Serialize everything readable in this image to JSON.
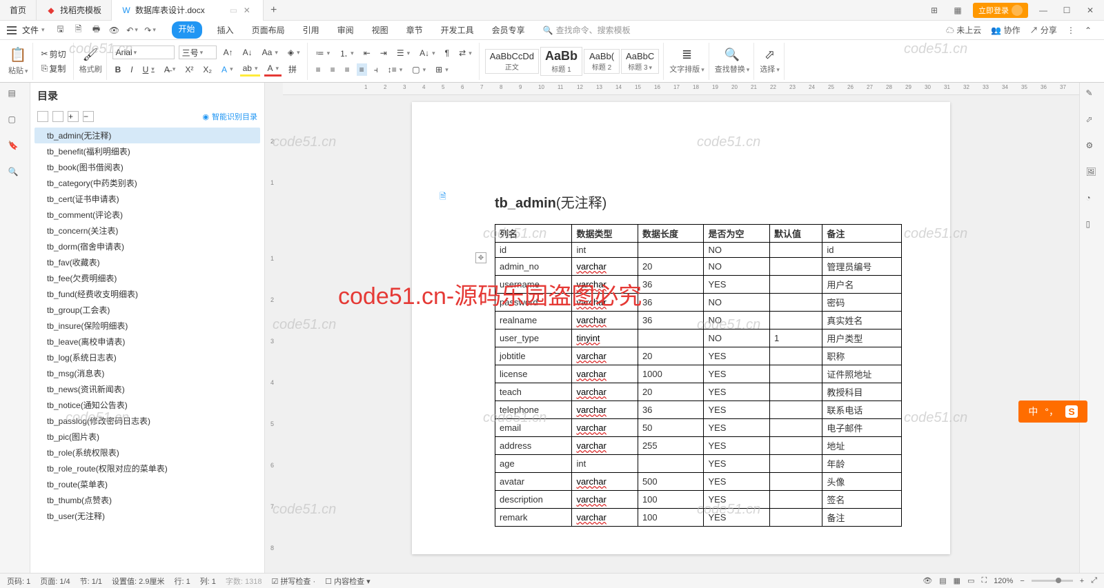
{
  "titlebar": {
    "tabs": [
      {
        "label": "首页",
        "icon_color": "#2196f3"
      },
      {
        "label": "找稻壳模板",
        "icon_color": "#e53935"
      },
      {
        "label": "数据库表设计.docx",
        "icon_color": "#2196f3",
        "active": true
      }
    ],
    "login": "立即登录"
  },
  "menubar": {
    "file": "文件",
    "tabs": [
      "开始",
      "插入",
      "页面布局",
      "引用",
      "审阅",
      "视图",
      "章节",
      "开发工具",
      "会员专享"
    ],
    "search_placeholder": "查找命令、搜索模板",
    "right": {
      "cloud": "未上云",
      "collab": "协作",
      "share": "分享"
    }
  },
  "ribbon": {
    "clipboard": {
      "paste": "粘贴",
      "cut": "剪切",
      "copy": "复制",
      "fmtpainter": "格式刷"
    },
    "font": {
      "name": "Arial",
      "size": "三号"
    },
    "styles": [
      {
        "preview": "AaBbCcDd",
        "label": "正文"
      },
      {
        "preview": "AaBb",
        "label": "标题 1",
        "big": true
      },
      {
        "preview": "AaBb(",
        "label": "标题 2"
      },
      {
        "preview": "AaBbC",
        "label": "标题 3"
      }
    ],
    "tools": {
      "layout": "文字排版",
      "findreplace": "查找替换",
      "select": "选择"
    }
  },
  "outline": {
    "title": "目录",
    "smart": "智能识别目录",
    "items": [
      "tb_admin(无注释)",
      "tb_benefit(福利明细表)",
      "tb_book(图书借阅表)",
      "tb_category(中药类别表)",
      "tb_cert(证书申请表)",
      "tb_comment(评论表)",
      "tb_concern(关注表)",
      "tb_dorm(宿舍申请表)",
      "tb_fav(收藏表)",
      "tb_fee(欠费明细表)",
      "tb_fund(经费收支明细表)",
      "tb_group(工会表)",
      "tb_insure(保险明细表)",
      "tb_leave(离校申请表)",
      "tb_log(系统日志表)",
      "tb_msg(消息表)",
      "tb_news(资讯新闻表)",
      "tb_notice(通知公告表)",
      "tb_passlog(修改密码日志表)",
      "tb_pic(图片表)",
      "tb_role(系统权限表)",
      "tb_role_route(权限对应的菜单表)",
      "tb_route(菜单表)",
      "tb_thumb(点赞表)",
      "tb_user(无注释)"
    ],
    "selected": 0
  },
  "document": {
    "heading_name": "tb_admin",
    "heading_note": "(无注释)",
    "columns": [
      "列名",
      "数据类型",
      "数据长度",
      "是否为空",
      "默认值",
      "备注"
    ],
    "rows": [
      [
        "id",
        "int",
        "",
        "NO",
        "",
        "id"
      ],
      [
        "admin_no",
        "varchar",
        "20",
        "NO",
        "",
        "管理员编号"
      ],
      [
        "username",
        "varchar",
        "36",
        "YES",
        "",
        "用户名"
      ],
      [
        "password",
        "varchar",
        "36",
        "NO",
        "",
        "密码"
      ],
      [
        "realname",
        "varchar",
        "36",
        "NO",
        "",
        "真实姓名"
      ],
      [
        "user_type",
        "tinyint",
        "",
        "NO",
        "1",
        "用户类型"
      ],
      [
        "jobtitle",
        "varchar",
        "20",
        "YES",
        "",
        "职称"
      ],
      [
        "license",
        "varchar",
        "1000",
        "YES",
        "",
        "证件照地址"
      ],
      [
        "teach",
        "varchar",
        "20",
        "YES",
        "",
        "教授科目"
      ],
      [
        "telephone",
        "varchar",
        "36",
        "YES",
        "",
        "联系电话"
      ],
      [
        "email",
        "varchar",
        "50",
        "YES",
        "",
        "电子邮件"
      ],
      [
        "address",
        "varchar",
        "255",
        "YES",
        "",
        "地址"
      ],
      [
        "age",
        "int",
        "",
        "YES",
        "",
        "年龄"
      ],
      [
        "avatar",
        "varchar",
        "500",
        "YES",
        "",
        "头像"
      ],
      [
        "description",
        "varchar",
        "100",
        "YES",
        "",
        "签名"
      ],
      [
        "remark",
        "varchar",
        "100",
        "YES",
        "",
        "备注"
      ]
    ]
  },
  "statusbar": {
    "page_no": "页码: 1",
    "page": "页面: 1/4",
    "section": "节: 1/1",
    "setval": "设置值: 2.9厘米",
    "line": "行: 1",
    "col": "列: 1",
    "words": "字数: 1318",
    "spell": "拼写检查",
    "content": "内容检查",
    "zoom": "120%"
  },
  "watermark": "code51.cn",
  "watermark_red": "code51.cn-源码乐园盗图必究",
  "ime": {
    "lang": "中"
  }
}
